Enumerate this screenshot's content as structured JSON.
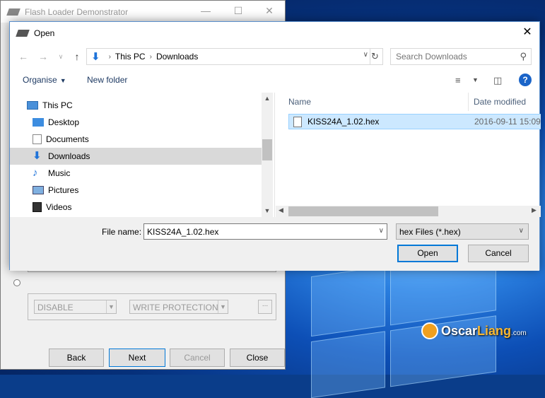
{
  "background_window": {
    "title": "Flash Loader Demonstrator",
    "select1": "DISABLE",
    "select2": "WRITE PROTECTION",
    "dots": "...",
    "buttons": {
      "back": "Back",
      "next": "Next",
      "cancel": "Cancel",
      "close": "Close"
    }
  },
  "dialog": {
    "title": "Open",
    "breadcrumb": [
      "This PC",
      "Downloads"
    ],
    "search_placeholder": "Search Downloads",
    "toolbar": {
      "organise": "Organise",
      "new_folder": "New folder"
    },
    "nav_items": [
      {
        "label": "This PC",
        "icon": "computer-icon"
      },
      {
        "label": "Desktop",
        "icon": "desktop-folder-icon"
      },
      {
        "label": "Documents",
        "icon": "documents-icon"
      },
      {
        "label": "Downloads",
        "icon": "download-arrow-icon",
        "selected": true
      },
      {
        "label": "Music",
        "icon": "music-note-icon"
      },
      {
        "label": "Pictures",
        "icon": "pictures-icon"
      },
      {
        "label": "Videos",
        "icon": "film-icon"
      }
    ],
    "columns": {
      "name": "Name",
      "date": "Date modified"
    },
    "files": [
      {
        "name": "KISS24A_1.02.hex",
        "date": "2016-09-11 15:09",
        "selected": true
      }
    ],
    "file_name_label": "File name:",
    "file_name_value": "KISS24A_1.02.hex",
    "file_type": "hex Files (*.hex)",
    "open_label": "Open",
    "cancel_label": "Cancel"
  },
  "watermark": {
    "brand_a": "Oscar",
    "brand_b": "Liang",
    "suffix": ".com"
  },
  "colors": {
    "selection": "#cce8ff",
    "accent": "#0078d7",
    "nav_selected": "#d9d9d9"
  }
}
